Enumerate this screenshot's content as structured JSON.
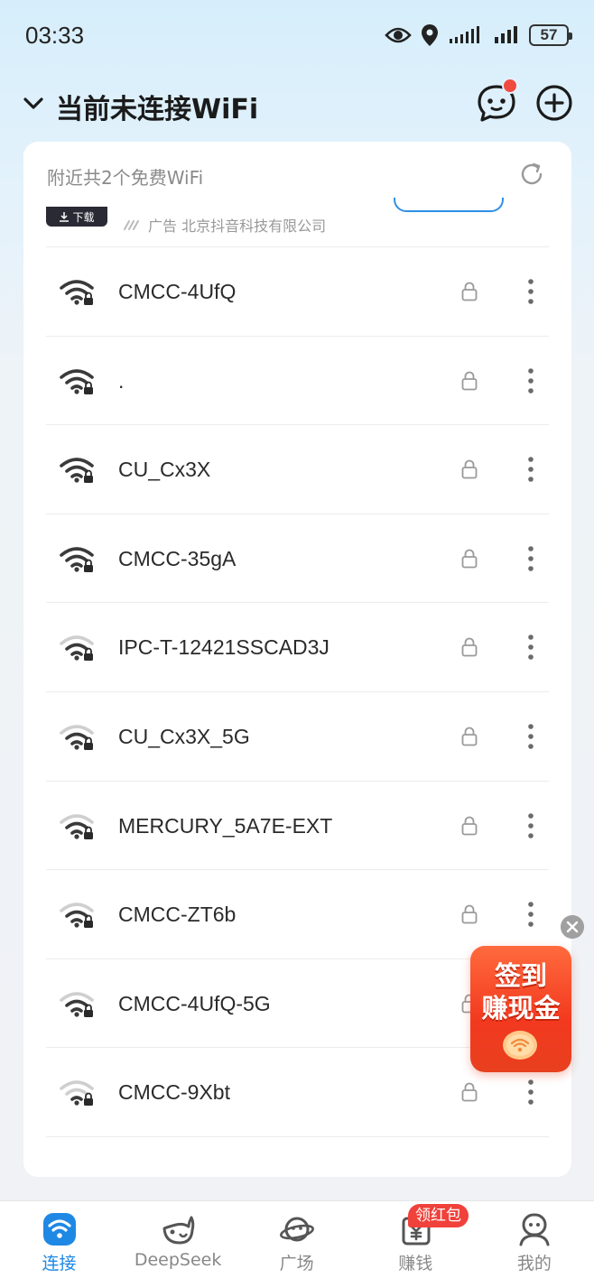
{
  "status_bar": {
    "time": "03:33",
    "battery": "57",
    "icons": [
      "eye-icon",
      "location-icon",
      "signal-icon",
      "signal-icon",
      "battery-icon"
    ]
  },
  "header": {
    "title": "当前未连接WiFi",
    "icons": [
      "chevron-down-icon",
      "message-icon",
      "add-circle-icon"
    ]
  },
  "card": {
    "title": "附近共2个免费WiFi",
    "ad": {
      "download_label": "下载",
      "sponsor_label": "广告 北京抖音科技有限公司"
    }
  },
  "wifi_list": [
    {
      "ssid": "CMCC-4UfQ",
      "signal": 3
    },
    {
      "ssid": ".",
      "signal": 3
    },
    {
      "ssid": "CU_Cx3X",
      "signal": 3
    },
    {
      "ssid": "CMCC-35gA",
      "signal": 3
    },
    {
      "ssid": "IPC-T-12421SSCAD3J",
      "signal": 2
    },
    {
      "ssid": "CU_Cx3X_5G",
      "signal": 2
    },
    {
      "ssid": "MERCURY_5A7E-EXT",
      "signal": 2
    },
    {
      "ssid": "CMCC-ZT6b",
      "signal": 2
    },
    {
      "ssid": "CMCC-4UfQ-5G",
      "signal": 2
    },
    {
      "ssid": "CMCC-9Xbt",
      "signal": 1
    }
  ],
  "promo": {
    "line1": "签到",
    "line2": "赚现金"
  },
  "tabbar": {
    "badge": "领红包",
    "tabs": [
      {
        "label": "连接",
        "icon": "wifi-icon",
        "active": true
      },
      {
        "label": "DeepSeek",
        "icon": "whale-icon",
        "active": false
      },
      {
        "label": "广场",
        "icon": "planet-icon",
        "active": false
      },
      {
        "label": "赚钱",
        "icon": "wallet-icon",
        "active": false
      },
      {
        "label": "我的",
        "icon": "profile-icon",
        "active": false
      }
    ]
  },
  "colors": {
    "accent": "#1e88e5",
    "promo": "#f2391f",
    "badge": "#f0413a"
  }
}
